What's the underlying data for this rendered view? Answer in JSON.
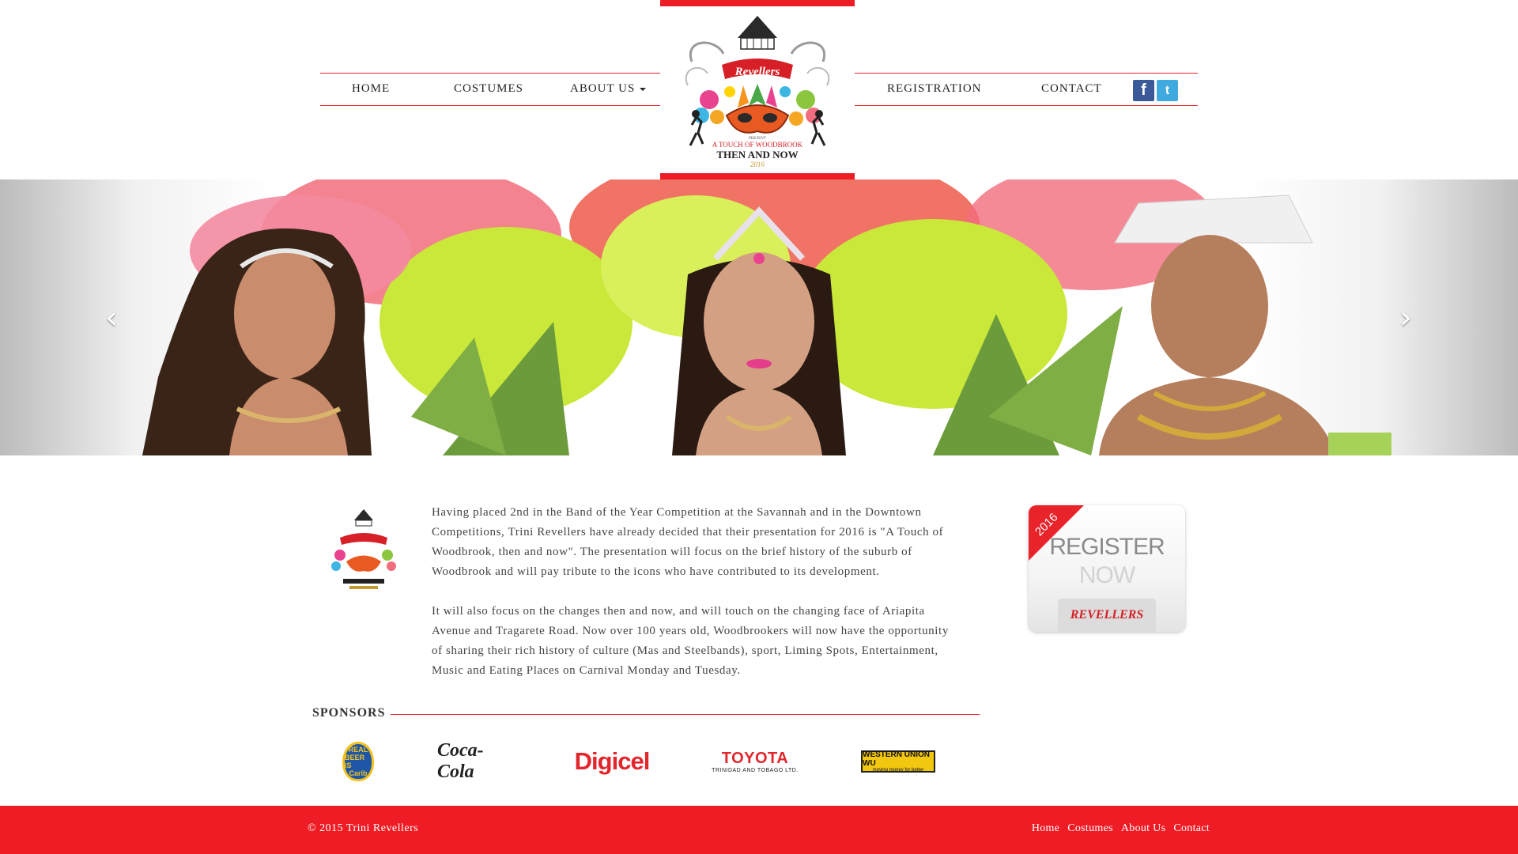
{
  "header": {
    "nav_left": [
      {
        "label": "HOME"
      },
      {
        "label": "COSTUMES"
      },
      {
        "label": "ABOUT US"
      }
    ],
    "nav_right": [
      {
        "label": "REGISTRATION"
      },
      {
        "label": "CONTACT"
      }
    ],
    "social": {
      "facebook_icon": "f",
      "twitter_icon": "t"
    },
    "logo": {
      "brand": "Revellers",
      "present": "PRESENT",
      "line1": "A TOUCH OF WOODBROOK",
      "line2": "THEN AND NOW",
      "year": "2016"
    }
  },
  "hero": {
    "prev_glyph": "‹",
    "next_glyph": "›",
    "colors": {
      "feathers_pink": "#f26d7d",
      "feathers_lime": "#c9e83a",
      "leaves": "#6c9b3c",
      "skin": "#c98c6c"
    }
  },
  "intro": {
    "paragraphs": [
      "Having placed 2nd in the Band of the Year Competition at the Savannah and in the Downtown Competitions, Trini Revellers have already decided that their presentation for 2016 is \"A Touch of Woodbrook, then and now\". The presentation will focus on the brief history of the suburb of Woodbrook and will pay tribute to the icons who have contributed to its development.",
      "It will also focus on the changes then and now, and will touch on the changing face of Ariapita Avenue and Tragarete Road. Now over 100 years old, Woodbrookers will now have the opportunity of sharing their rich history of culture (Mas and Steelbands), sport, Liming Spots, Entertainment, Music and Eating Places on Carnival Monday and Tuesday."
    ]
  },
  "register": {
    "year": "2016",
    "line1": "REGISTER",
    "line2": "NOW",
    "brand": "REVELLERS"
  },
  "sponsors": {
    "title": "SPONSORS",
    "carib": {
      "l1": "REAL",
      "l2": "BEER IS",
      "l3": "Carib"
    },
    "coke": "Coca-Cola",
    "digicel": "Digicel",
    "toyota": {
      "name": "TOYOTA",
      "sub": "TRINIDAD AND TOBAGO LTD."
    },
    "wu": {
      "name": "WESTERN UNION WU",
      "tagline": "moving money for better"
    }
  },
  "footer": {
    "copyright": "© 2015 Trini Revellers",
    "links": [
      "Home",
      "Costumes",
      "About Us",
      "Contact"
    ]
  },
  "colors": {
    "accent": "#ee1c25",
    "text": "#444444"
  }
}
